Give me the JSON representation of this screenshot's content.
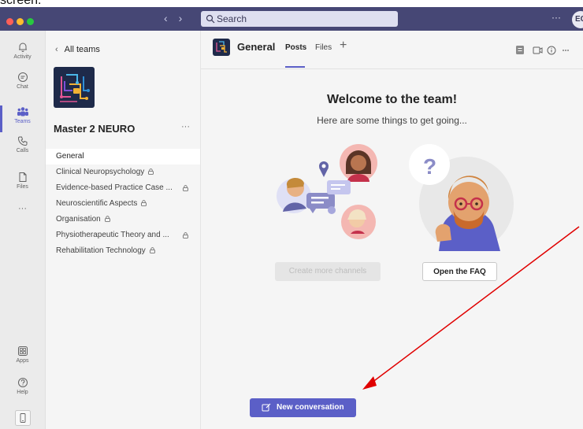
{
  "top_fragment": "screen.",
  "window": {
    "search_placeholder": "Search",
    "more_label": "···",
    "avatar_initials": "EC"
  },
  "rail": {
    "items": [
      {
        "label": "Activity",
        "icon": "bell-icon"
      },
      {
        "label": "Chat",
        "icon": "chat-icon"
      },
      {
        "label": "Teams",
        "icon": "teams-icon"
      },
      {
        "label": "Calls",
        "icon": "phone-icon"
      },
      {
        "label": "Files",
        "icon": "file-icon"
      },
      {
        "label": "···",
        "icon": "more-icon"
      },
      {
        "label": "Apps",
        "icon": "apps-icon"
      },
      {
        "label": "Help",
        "icon": "help-icon"
      }
    ]
  },
  "panel": {
    "back_label": "All teams",
    "team_name": "Master 2 NEURO",
    "more_label": "···",
    "channels": [
      {
        "label": "General"
      },
      {
        "label": "Clinical Neuropsychology"
      },
      {
        "label": "Evidence-based Practice Case ..."
      },
      {
        "label": "Neuroscientific Aspects"
      },
      {
        "label": "Organisation"
      },
      {
        "label": "Physiotherapeutic Theory and ..."
      },
      {
        "label": "Rehabilitation Technology"
      }
    ]
  },
  "main": {
    "channel_title": "General",
    "tabs": [
      {
        "label": "Posts"
      },
      {
        "label": "Files"
      }
    ],
    "add_tab": "+",
    "header_more": "···",
    "welcome_title": "Welcome to the team!",
    "welcome_subtitle": "Here are some things to get going...",
    "create_channels_label": "Create more channels",
    "faq_label": "Open the FAQ",
    "new_conversation_label": "New conversation"
  },
  "colors": {
    "titlebar": "#464775",
    "accent": "#5b5fc7",
    "arrow": "#e00000"
  }
}
